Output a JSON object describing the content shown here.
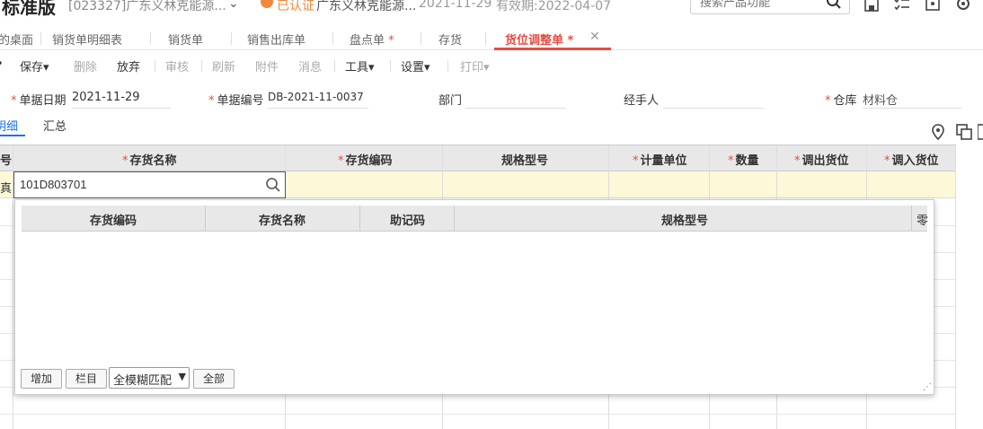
{
  "topbar": {
    "brand": "标准版",
    "company": "[023327]广东义林克能源...",
    "certified": "已认证",
    "cert_company": "广东义林克能源...",
    "date": "2021-11-29",
    "expiry": "有效期:2022-04-07",
    "search_placeholder": "搜索产品功能"
  },
  "tabs": [
    {
      "label": "的桌面"
    },
    {
      "label": "销货单明细表"
    },
    {
      "label": "销货单"
    },
    {
      "label": "销售出库单"
    },
    {
      "label": "盘点单",
      "star": "*"
    },
    {
      "label": "存货"
    },
    {
      "label": "货位调整单",
      "star": "*",
      "active": true
    }
  ],
  "toolbar": {
    "save": "保存",
    "delete": "删除",
    "abandon": "放弃",
    "audit": "审核",
    "refresh": "刷新",
    "attachment": "附件",
    "message": "消息",
    "tools": "工具",
    "settings": "设置",
    "print": "打印"
  },
  "form": {
    "doc_date_label": "单据日期",
    "doc_date": "2021-11-29",
    "doc_no_label": "单据编号",
    "doc_no": "DB-2021-11-0037",
    "dept_label": "部门",
    "dept": "",
    "handler_label": "经手人",
    "handler": "",
    "warehouse_label": "仓库",
    "warehouse": "材料仓"
  },
  "subtabs": {
    "detail": "明细",
    "summary": "汇总"
  },
  "grid": {
    "row_no_header": "号",
    "columns": [
      "存货名称",
      "存货编码",
      "规格型号",
      "计量单位",
      "数量",
      "调出货位",
      "调入货位"
    ],
    "row_indicator": "真",
    "edit_value": "101D803701"
  },
  "popup": {
    "columns": [
      "存货编码",
      "存货名称",
      "助记码",
      "规格型号",
      "零"
    ],
    "add": "增加",
    "columns_btn": "栏目",
    "match_mode": "全模糊匹配",
    "all": "全部"
  }
}
